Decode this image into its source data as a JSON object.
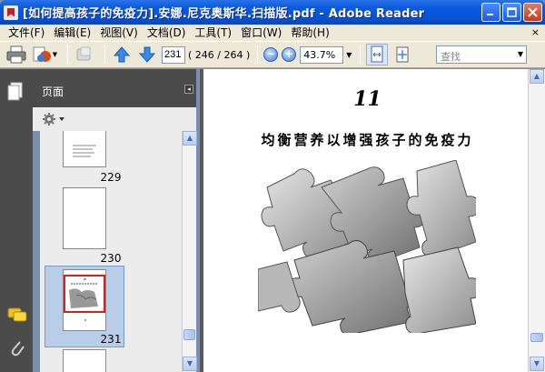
{
  "window": {
    "title": "[如何提高孩子的免疫力].安娜.尼克奥斯华.扫描版.pdf - Adobe Reader"
  },
  "menu": {
    "items": [
      "文件(F)",
      "编辑(E)",
      "视图(V)",
      "文档(D)",
      "工具(T)",
      "窗口(W)",
      "帮助(H)"
    ],
    "close_doc": "×"
  },
  "toolbar": {
    "page_current": "231",
    "page_count": "( 246 / 264 )",
    "zoom": "43.7%",
    "search_placeholder": "查找"
  },
  "pages_panel": {
    "title": "页面",
    "thumbnails": [
      {
        "label": "229"
      },
      {
        "label": "230"
      },
      {
        "label": "231",
        "selected": true
      }
    ]
  },
  "document": {
    "chapter_number": "11",
    "chapter_title": "均衡营养以增强孩子的免疫力"
  },
  "colors": {
    "titlebar": "#0a5ae0",
    "selection": "#b8cde8",
    "accent_red": "#c8202a"
  }
}
